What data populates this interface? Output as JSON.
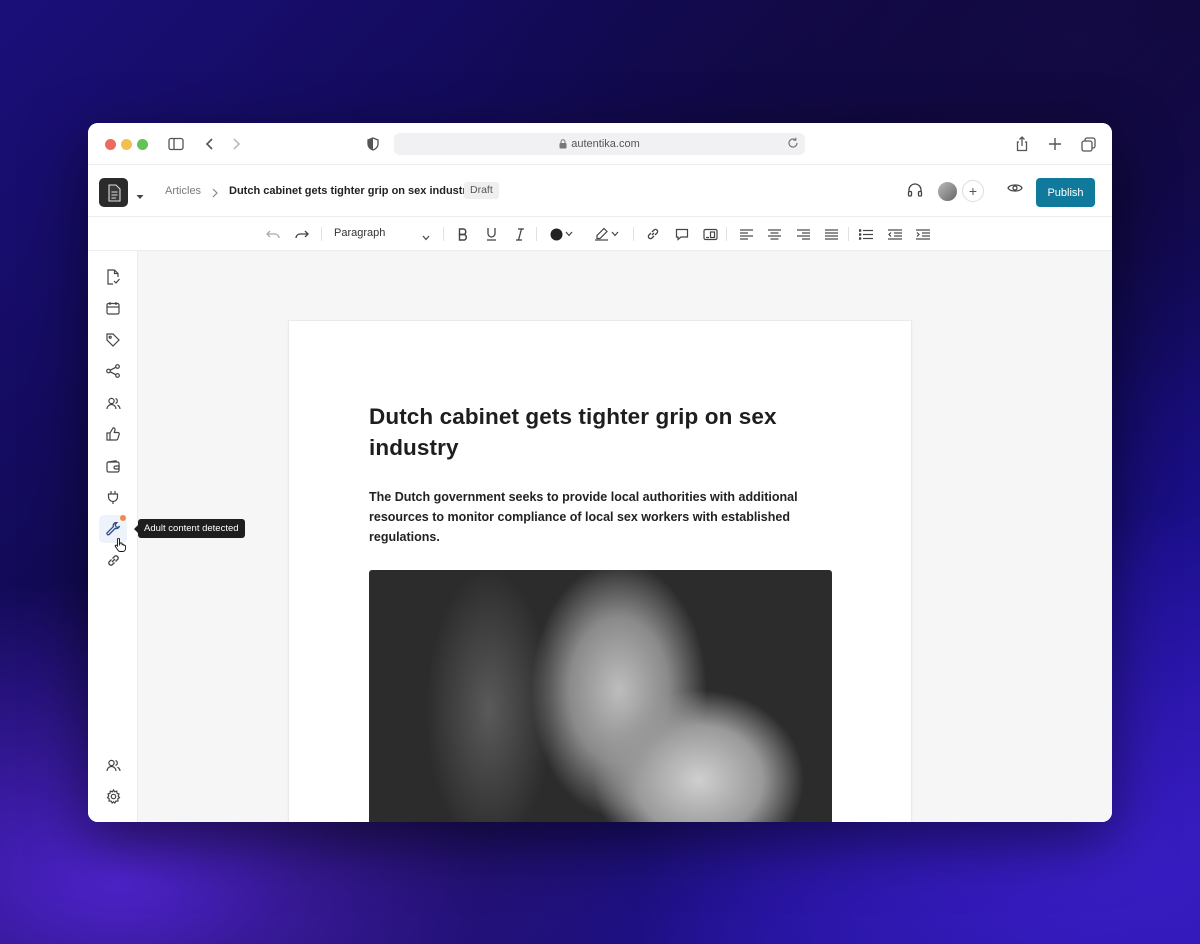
{
  "browser": {
    "url": "autentika.com"
  },
  "header": {
    "breadcrumb_root": "Articles",
    "breadcrumb_title": "Dutch cabinet gets tighter grip on sex industry",
    "status_badge": "Draft",
    "add_label": "+",
    "publish_label": "Publish"
  },
  "toolbar": {
    "block_style": "Paragraph",
    "text_color": "#222222"
  },
  "sidebar": {
    "icons": [
      "document-check-icon",
      "calendar-icon",
      "tag-icon",
      "share-icon",
      "people-icon",
      "thumbs-up-icon",
      "wallet-icon",
      "plug-icon",
      "tools-icon",
      "link-icon",
      "team-icon",
      "settings-icon"
    ],
    "active": "tools-icon",
    "tooltip": "Adult content detected",
    "notification_color": "#f08a4b"
  },
  "article": {
    "title": "Dutch cabinet gets tighter grip on sex industry",
    "lead": "The Dutch government seeks to provide local authorities with additional resources to monitor compliance of local sex workers with established regulations."
  },
  "colors": {
    "publish": "#107a9c"
  }
}
